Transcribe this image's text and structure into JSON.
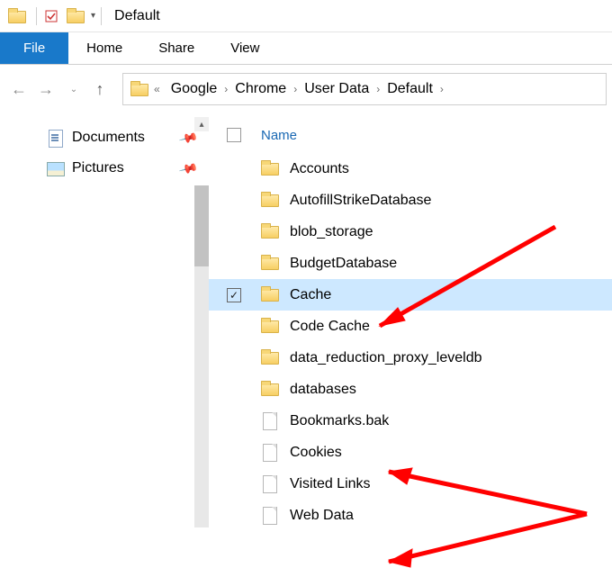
{
  "title_bar": {
    "window_title": "Default"
  },
  "ribbon": {
    "file": "File",
    "tabs": [
      "Home",
      "Share",
      "View"
    ]
  },
  "breadcrumbs": {
    "overflow_indicator": "«",
    "segments": [
      "Google",
      "Chrome",
      "User Data",
      "Default"
    ]
  },
  "sidebar": {
    "items": [
      {
        "label": "Documents",
        "icon": "document-icon",
        "pinned": true
      },
      {
        "label": "Pictures",
        "icon": "pictures-icon",
        "pinned": true
      }
    ]
  },
  "main": {
    "columns": {
      "name": "Name"
    },
    "items": [
      {
        "name": "Accounts",
        "type": "folder",
        "checked": false,
        "selected": false
      },
      {
        "name": "AutofillStrikeDatabase",
        "type": "folder",
        "checked": false,
        "selected": false
      },
      {
        "name": "blob_storage",
        "type": "folder",
        "checked": false,
        "selected": false
      },
      {
        "name": "BudgetDatabase",
        "type": "folder",
        "checked": false,
        "selected": false
      },
      {
        "name": "Cache",
        "type": "folder",
        "checked": true,
        "selected": true
      },
      {
        "name": "Code Cache",
        "type": "folder",
        "checked": false,
        "selected": false
      },
      {
        "name": "data_reduction_proxy_leveldb",
        "type": "folder",
        "checked": false,
        "selected": false
      },
      {
        "name": "databases",
        "type": "folder",
        "checked": false,
        "selected": false
      },
      {
        "name": "Bookmarks.bak",
        "type": "file",
        "checked": false,
        "selected": false
      },
      {
        "name": "Cookies",
        "type": "file",
        "checked": false,
        "selected": false
      },
      {
        "name": "Visited Links",
        "type": "file",
        "checked": false,
        "selected": false
      },
      {
        "name": "Web Data",
        "type": "file",
        "checked": false,
        "selected": false
      }
    ]
  }
}
